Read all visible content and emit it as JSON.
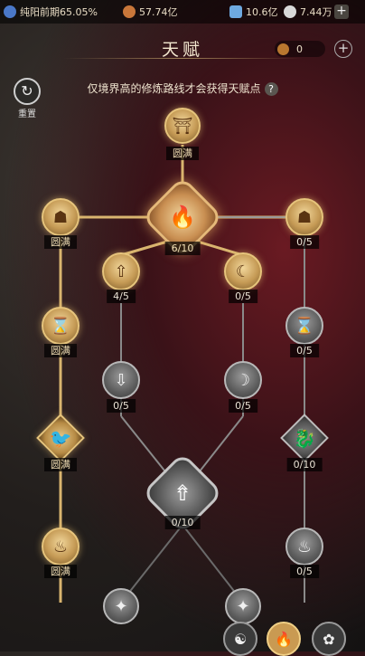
{
  "topbar": {
    "realm_icon": "realm-icon",
    "realm_text": "纯阳前期65.05%",
    "currency1_icon": "coin-pouch-icon",
    "currency1": "57.74亿",
    "currency2_icon": "spirit-crystal-icon",
    "currency2": "10.6亿",
    "currency3_icon": "jade-icon",
    "currency3": "7.44万",
    "plus_label": "+"
  },
  "header": {
    "title": "天赋",
    "points_icon": "talent-point-icon",
    "points": "0",
    "plus_label": "+"
  },
  "reset": {
    "icon": "refresh-icon",
    "label": "重置"
  },
  "hint": {
    "text": "仅境界高的修炼路线才会获得天赋点",
    "help_label": "?"
  },
  "nodes": [
    {
      "id": "root",
      "icon": "shrine-icon",
      "label": "圆满",
      "state": "gold"
    },
    {
      "id": "center",
      "icon": "flame-icon",
      "label": "6/10",
      "state": "gold"
    },
    {
      "id": "left-top",
      "icon": "demon-mask-icon",
      "label": "圆满",
      "state": "gold"
    },
    {
      "id": "right-top",
      "icon": "demon-mask-icon",
      "label": "0/5",
      "state": "silver"
    },
    {
      "id": "c-left-1",
      "icon": "arrow-up-icon",
      "label": "4/5",
      "state": "gold"
    },
    {
      "id": "c-right-1",
      "icon": "moon-arrow-icon",
      "label": "0/5",
      "state": "gold"
    },
    {
      "id": "left-2",
      "icon": "hourglass-icon",
      "label": "圆满",
      "state": "gold"
    },
    {
      "id": "right-2",
      "icon": "hourglass-icon",
      "label": "0/5",
      "state": "silver"
    },
    {
      "id": "c-left-2",
      "icon": "arrow-down-icon",
      "label": "0/5",
      "state": "silver"
    },
    {
      "id": "c-right-2",
      "icon": "moon-icon",
      "label": "0/5",
      "state": "silver"
    },
    {
      "id": "left-3",
      "icon": "bird-icon",
      "label": "圆满",
      "state": "gold"
    },
    {
      "id": "right-3",
      "icon": "dragon-icon",
      "label": "0/10",
      "state": "silver"
    },
    {
      "id": "center-big",
      "icon": "flame-arrow-icon",
      "label": "0/10",
      "state": "silver"
    },
    {
      "id": "left-4",
      "icon": "fire-icon",
      "label": "圆满",
      "state": "gold"
    },
    {
      "id": "right-4",
      "icon": "fire-icon",
      "label": "0/5",
      "state": "silver"
    }
  ],
  "bottom_tabs": [
    {
      "icon": "path-icon-1"
    },
    {
      "icon": "path-icon-2"
    },
    {
      "icon": "path-icon-3"
    }
  ]
}
